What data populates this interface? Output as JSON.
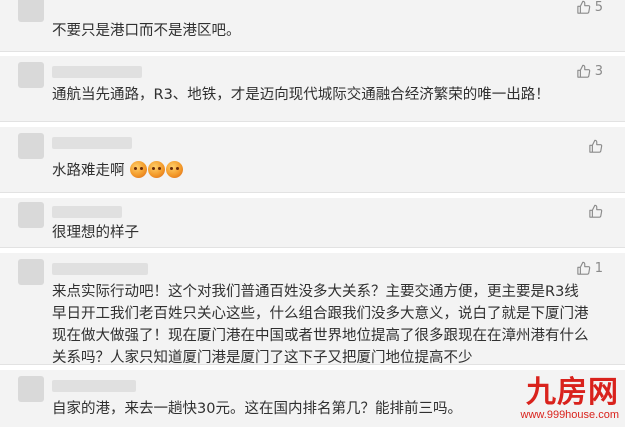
{
  "comments": [
    {
      "text": "不要只是港口而不是港区吧。",
      "likes": "5"
    },
    {
      "text": "通航当先通路，R3、地铁，才是迈向现代城际交通融合经济繁荣的唯一出路！",
      "likes": "3"
    },
    {
      "text": "水路难走啊",
      "likes": "",
      "emoji": [
        "grimace-emoji",
        "grimace-emoji",
        "grimace-emoji"
      ]
    },
    {
      "text": "很理想的样子",
      "likes": ""
    },
    {
      "text": "来点实际行动吧！这个对我们普通百姓没多大关系？主要交通方便，更主要是R3线早日开工我们老百姓只关心这些，什么组合跟我们没多大意义，说白了就是下厦门港现在做大做强了！现在厦门港在中国或者世界地位提高了很多跟现在在漳州港有什么关系吗？人家只知道厦门港是厦门了这下子又把厦门地位提高不少",
      "likes": "1"
    },
    {
      "text": "自家的港，来去一趟快30元。这在国内排名第几？能排前三吗。",
      "likes": ""
    }
  ],
  "watermark": {
    "logo": "九房网",
    "url": "www.999house.com"
  },
  "icons": {
    "like": "thumbs-up-icon"
  },
  "colors": {
    "card_bg": "#f3f3f3",
    "text": "#303030",
    "icon": "#8a8a8a",
    "watermark": "#d9221c"
  }
}
